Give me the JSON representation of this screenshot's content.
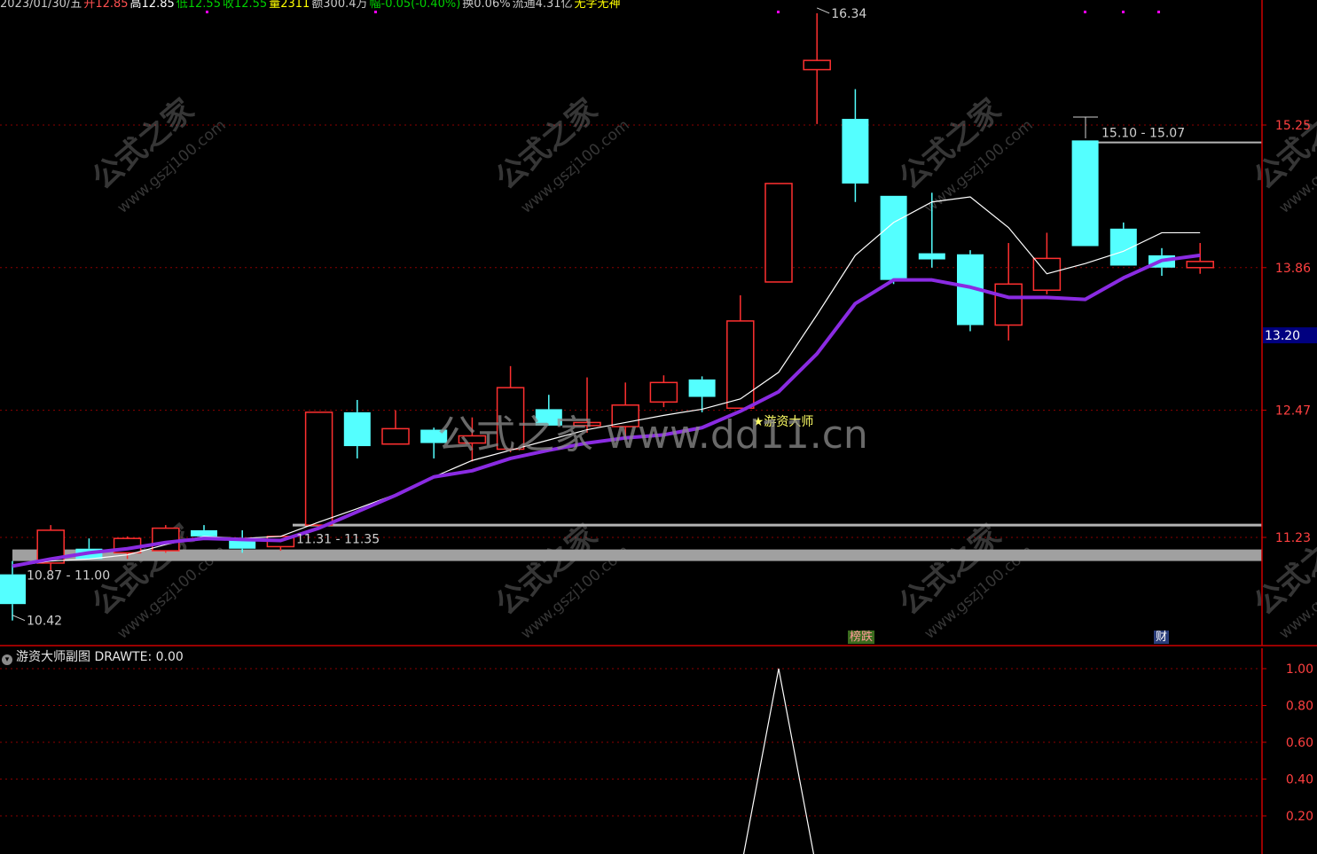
{
  "header": {
    "items": [
      {
        "text": "2023/01/30/五",
        "color": "#c8c8c8"
      },
      {
        "text": "开12.85",
        "color": "#ff5050"
      },
      {
        "text": "高12.85",
        "color": "#ffffff"
      },
      {
        "text": "低12.55",
        "color": "#00d000"
      },
      {
        "text": "收12.55",
        "color": "#00d000"
      },
      {
        "text": "量2311",
        "color": "#ffff00"
      },
      {
        "text": "额300.4万",
        "color": "#c8c8c8"
      },
      {
        "text": "幅-0.05(-0.40%)",
        "color": "#00d000"
      },
      {
        "text": "换0.06%",
        "color": "#c8c8c8"
      },
      {
        "text": "流通4.31亿",
        "color": "#c8c8c8"
      },
      {
        "text": "无字无神",
        "color": "#ffff00"
      }
    ]
  },
  "watermark": {
    "center_text": "公式之家 www.dd11.cn",
    "tile_cn": "公式之家",
    "tile_url": "www.gszj100.com"
  },
  "signal_label": "★游资大师",
  "event_badges": [
    {
      "text": "榜跌",
      "bg": "#3a6b1e",
      "color": "#ff9999"
    },
    {
      "text": "财",
      "bg": "#2a3d7a",
      "color": "#ffffff"
    }
  ],
  "sub_panel": {
    "title": "游资大师副图",
    "indicator": "DRAWTE: 0.00",
    "ticks": [
      "1.00",
      "0.80",
      "0.60",
      "0.40",
      "0.20"
    ]
  },
  "colors": {
    "background": "#000000",
    "up_candle": "#ff3030",
    "down_candle": "#54ffff",
    "ma_fast": "#ffffff",
    "ma_slow": "#8a2be2",
    "grid": "#8b0000",
    "axis": "#cc0000",
    "axis_text": "#ff4040",
    "support_line": "#b4b4b4",
    "current_price_bg": "#000080"
  },
  "chart_data": [
    {
      "type": "candlestick",
      "title": "",
      "y_ticks": [
        "15.25",
        "13.86",
        "12.47",
        "11.23"
      ],
      "ylim": [
        10.2,
        16.5
      ],
      "current_price": "13.20",
      "candles": [
        {
          "o": 10.87,
          "h": 11.0,
          "l": 10.42,
          "c": 10.58
        },
        {
          "o": 10.98,
          "h": 11.35,
          "l": 10.9,
          "c": 11.3
        },
        {
          "o": 11.12,
          "h": 11.22,
          "l": 11.05,
          "c": 11.02
        },
        {
          "o": 11.08,
          "h": 11.24,
          "l": 11.02,
          "c": 11.22
        },
        {
          "o": 11.1,
          "h": 11.35,
          "l": 11.08,
          "c": 11.32
        },
        {
          "o": 11.3,
          "h": 11.35,
          "l": 11.22,
          "c": 11.24
        },
        {
          "o": 11.22,
          "h": 11.3,
          "l": 11.08,
          "c": 11.12
        },
        {
          "o": 11.14,
          "h": 11.24,
          "l": 11.1,
          "c": 11.24
        },
        {
          "o": 11.35,
          "h": 12.45,
          "l": 11.33,
          "c": 12.45
        },
        {
          "o": 12.45,
          "h": 12.57,
          "l": 12.0,
          "c": 12.12
        },
        {
          "o": 12.14,
          "h": 12.47,
          "l": 12.14,
          "c": 12.29
        },
        {
          "o": 12.28,
          "h": 12.3,
          "l": 12.0,
          "c": 12.15
        },
        {
          "o": 12.15,
          "h": 12.4,
          "l": 11.97,
          "c": 12.22
        },
        {
          "o": 12.09,
          "h": 12.9,
          "l": 12.06,
          "c": 12.69
        },
        {
          "o": 12.48,
          "h": 12.62,
          "l": 12.4,
          "c": 12.32
        },
        {
          "o": 12.32,
          "h": 12.79,
          "l": 12.25,
          "c": 12.35
        },
        {
          "o": 12.31,
          "h": 12.74,
          "l": 12.2,
          "c": 12.52
        },
        {
          "o": 12.55,
          "h": 12.81,
          "l": 12.5,
          "c": 12.74
        },
        {
          "o": 12.77,
          "h": 12.8,
          "l": 12.45,
          "c": 12.6
        },
        {
          "o": 12.49,
          "h": 13.59,
          "l": 12.49,
          "c": 13.34
        },
        {
          "o": 13.72,
          "h": 14.68,
          "l": 13.72,
          "c": 14.68
        },
        {
          "o": 15.79,
          "h": 16.34,
          "l": 15.26,
          "c": 15.88
        },
        {
          "o": 15.31,
          "h": 15.6,
          "l": 14.5,
          "c": 14.68
        },
        {
          "o": 14.56,
          "h": 14.56,
          "l": 13.7,
          "c": 13.74
        },
        {
          "o": 14.0,
          "h": 14.59,
          "l": 13.86,
          "c": 13.94
        },
        {
          "o": 13.99,
          "h": 14.03,
          "l": 13.24,
          "c": 13.3
        },
        {
          "o": 13.3,
          "h": 14.1,
          "l": 13.15,
          "c": 13.7
        },
        {
          "o": 13.64,
          "h": 14.2,
          "l": 13.6,
          "c": 13.95
        },
        {
          "o": 15.1,
          "h": 15.1,
          "l": 14.1,
          "c": 14.07
        },
        {
          "o": 14.24,
          "h": 14.3,
          "l": 13.88,
          "c": 13.88
        },
        {
          "o": 13.98,
          "h": 14.05,
          "l": 13.78,
          "c": 13.86
        },
        {
          "o": 13.86,
          "h": 14.1,
          "l": 13.8,
          "c": 13.92
        }
      ],
      "ma_fast": [
        10.95,
        11.0,
        11.02,
        11.06,
        11.16,
        11.24,
        11.22,
        11.24,
        11.38,
        11.51,
        11.65,
        11.82,
        11.98,
        12.08,
        12.18,
        12.28,
        12.35,
        12.42,
        12.48,
        12.58,
        12.84,
        13.4,
        13.98,
        14.3,
        14.5,
        14.55,
        14.25,
        13.8,
        13.9,
        14.02,
        14.2,
        14.2
      ],
      "ma_slow": [
        10.95,
        11.02,
        11.08,
        11.12,
        11.18,
        11.22,
        11.21,
        11.2,
        11.32,
        11.48,
        11.64,
        11.82,
        11.88,
        12.0,
        12.08,
        12.15,
        12.2,
        12.23,
        12.3,
        12.46,
        12.65,
        13.02,
        13.51,
        13.74,
        13.74,
        13.67,
        13.57,
        13.57,
        13.55,
        13.76,
        13.93,
        13.98
      ],
      "support_lines": [
        11.35,
        11.0
      ],
      "range_labels": [
        "11.31 - 11.35",
        "10.87 - 11.00",
        "15.10 - 15.07"
      ],
      "extreme_labels": [
        "16.34",
        "10.42"
      ]
    },
    {
      "type": "line",
      "title": "游资大师副图",
      "series": [
        {
          "name": "DRAWTE",
          "values": [
            0,
            0,
            0,
            0,
            0,
            0,
            0,
            0,
            0,
            0,
            0,
            0,
            0,
            0,
            0,
            0,
            0,
            0,
            0,
            0,
            1,
            0,
            0,
            0,
            0,
            0,
            0,
            0,
            0,
            0,
            0,
            0
          ]
        }
      ],
      "ylim": [
        0,
        1.05
      ]
    }
  ]
}
